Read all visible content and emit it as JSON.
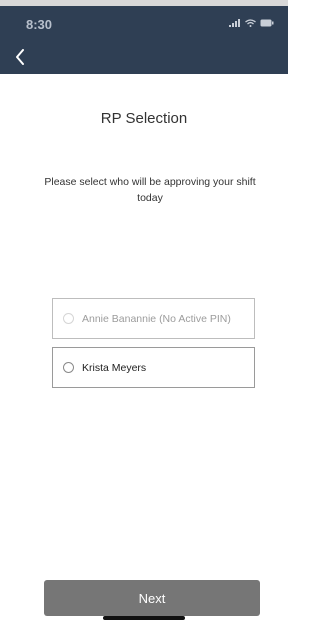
{
  "status_bar": {
    "time": "8:30"
  },
  "nav": {
    "back_icon": "chevron-left-icon"
  },
  "page": {
    "title": "RP Selection",
    "prompt": "Please select who will be approving your shift today"
  },
  "options": [
    {
      "label": "Annie Banannie (No Active PIN)",
      "disabled": true
    },
    {
      "label": "Krista Meyers",
      "disabled": false
    }
  ],
  "footer": {
    "next_label": "Next"
  },
  "colors": {
    "header_bg": "#2f3f54",
    "button_bg": "#767676"
  }
}
